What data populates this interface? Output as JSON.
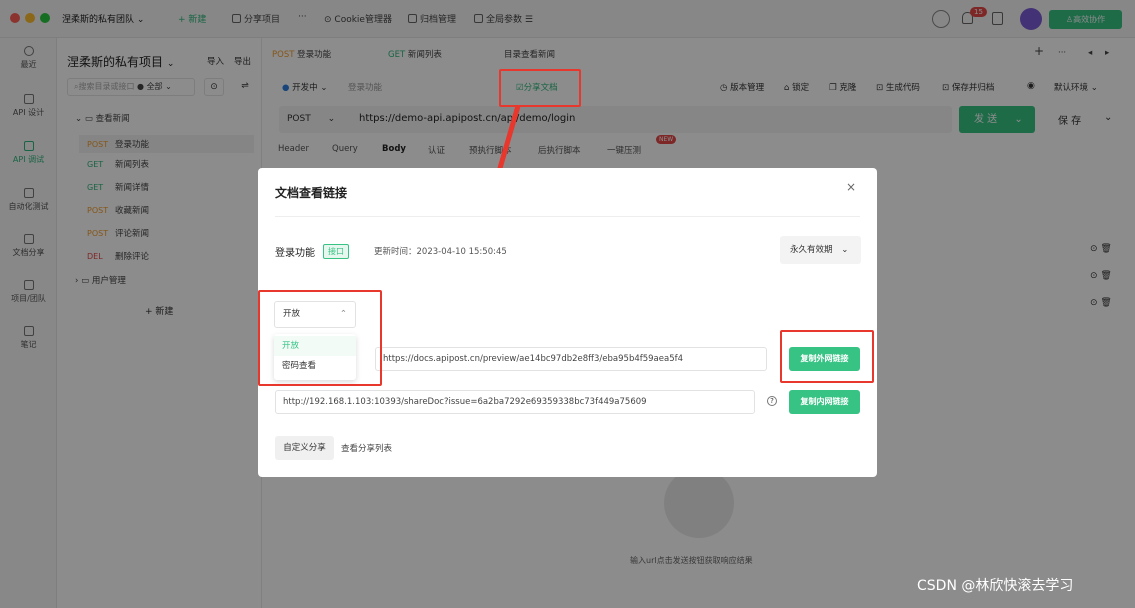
{
  "app": {
    "team": "涅柔斯的私有团队",
    "new_label": "+ 新建",
    "share_project": "分享项目",
    "more": "···",
    "cookie_manager": "Cookie管理器",
    "archive_manager": "归档管理",
    "global_params": "全局参数",
    "notification_count": "15",
    "collab_label": "高效协作"
  },
  "nav": {
    "items": [
      {
        "label": "最近"
      },
      {
        "label": "API 设计"
      },
      {
        "label": "API 调试"
      },
      {
        "label": "自动化测试"
      },
      {
        "label": "文档分享"
      },
      {
        "label": "项目/团队"
      },
      {
        "label": "笔记"
      }
    ]
  },
  "project": {
    "title": "涅柔斯的私有项目",
    "import": "导入",
    "export": "导出",
    "search_placeholder": "搜索目录或接口",
    "filter": "全部",
    "folder1": "查看新闻",
    "items": [
      {
        "method": "POST",
        "name": "登录功能"
      },
      {
        "method": "GET",
        "name": "新闻列表"
      },
      {
        "method": "GET",
        "name": "新闻详情"
      },
      {
        "method": "POST",
        "name": "收藏新闻"
      },
      {
        "method": "POST",
        "name": "评论新闻"
      },
      {
        "method": "DEL",
        "name": "删除评论"
      }
    ],
    "folder2": "用户管理",
    "new_btn": "+ 新建"
  },
  "main": {
    "tabs": [
      {
        "method": "POST",
        "name": "登录功能"
      },
      {
        "method": "GET",
        "name": "新闻列表"
      },
      {
        "method": "",
        "name": "目录查看新闻"
      }
    ],
    "status": "开发中",
    "api_name": "登录功能",
    "share_doc": "分享文档",
    "version_manager": "版本管理",
    "lock": "锁定",
    "clone": "克隆",
    "gen_code": "生成代码",
    "save_archive": "保存并归档",
    "env": "默认环境",
    "method": "POST",
    "url": "https://demo-api.apipost.cn/api/demo/login",
    "send": "发 送",
    "save": "保 存",
    "subtabs": [
      "Header",
      "Query",
      "Body",
      "认证",
      "预执行脚本",
      "后执行脚本",
      "一键压测"
    ],
    "new_badge": "NEW",
    "empty_hint": "输入url点击发送按钮获取响应结果"
  },
  "modal": {
    "title": "文档查看链接",
    "api_name": "登录功能",
    "tag": "接口",
    "update_time": "更新时间：2023-04-10 15:50:45",
    "validity": "永久有效期",
    "access_selected": "开放",
    "access_options": [
      "开放",
      "密码查看"
    ],
    "external_url": "https://docs.apipost.cn/preview/ae14bc97db2e8ff3/eba95b4f59aea5f4",
    "copy_external": "复制外网链接",
    "internal_url": "http://192.168.1.103:10393/shareDoc?issue=6a2ba7292e69359338bc73f449a75609",
    "copy_internal": "复制内网链接",
    "custom_share": "自定义分享",
    "share_list": "查看分享列表"
  },
  "watermark": "CSDN @林欣快滚去学习",
  "colors": {
    "accent": "#37c384",
    "annotation": "#e8372c",
    "post": "#f39c2b",
    "delete": "#e54848"
  }
}
